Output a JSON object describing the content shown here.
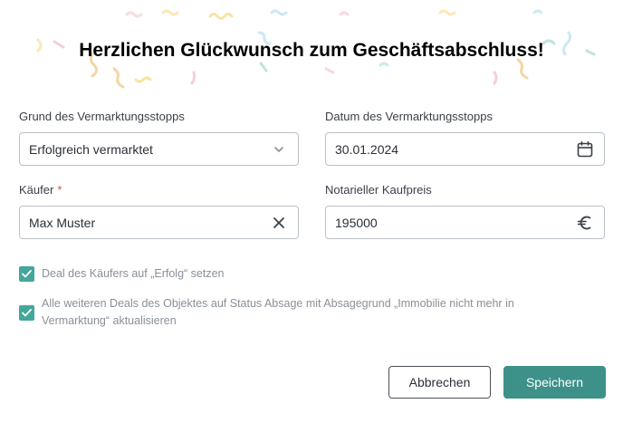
{
  "dialog": {
    "title": "Herzlichen Glückwunsch zum Geschäftsabschluss!"
  },
  "form": {
    "reason": {
      "label": "Grund des Vermarktungsstopps",
      "value": "Erfolgreich vermarktet",
      "icon": "chevron-down-icon"
    },
    "date": {
      "label": "Datum des Vermarktungsstopps",
      "value": "30.01.2024",
      "icon": "calendar-icon"
    },
    "buyer": {
      "label": "Käufer",
      "required_mark": "*",
      "value": "Max Muster",
      "icon": "clear-icon"
    },
    "price": {
      "label": "Notarieller Kaufpreis",
      "value": "195000",
      "icon": "euro-icon"
    }
  },
  "checkboxes": [
    {
      "label": "Deal des Käufers auf „Erfolg“ setzen",
      "checked": true
    },
    {
      "label": "Alle weiteren Deals des Objektes auf Status Absage mit Absagegrund „Immobilie nicht mehr in Vermarktung“ aktualisieren",
      "checked": true
    }
  ],
  "actions": {
    "cancel_label": "Abbrechen",
    "save_label": "Speichern"
  },
  "colors": {
    "accent": "#44a79c",
    "primary_button": "#3d9188",
    "required": "#e04a3f"
  }
}
